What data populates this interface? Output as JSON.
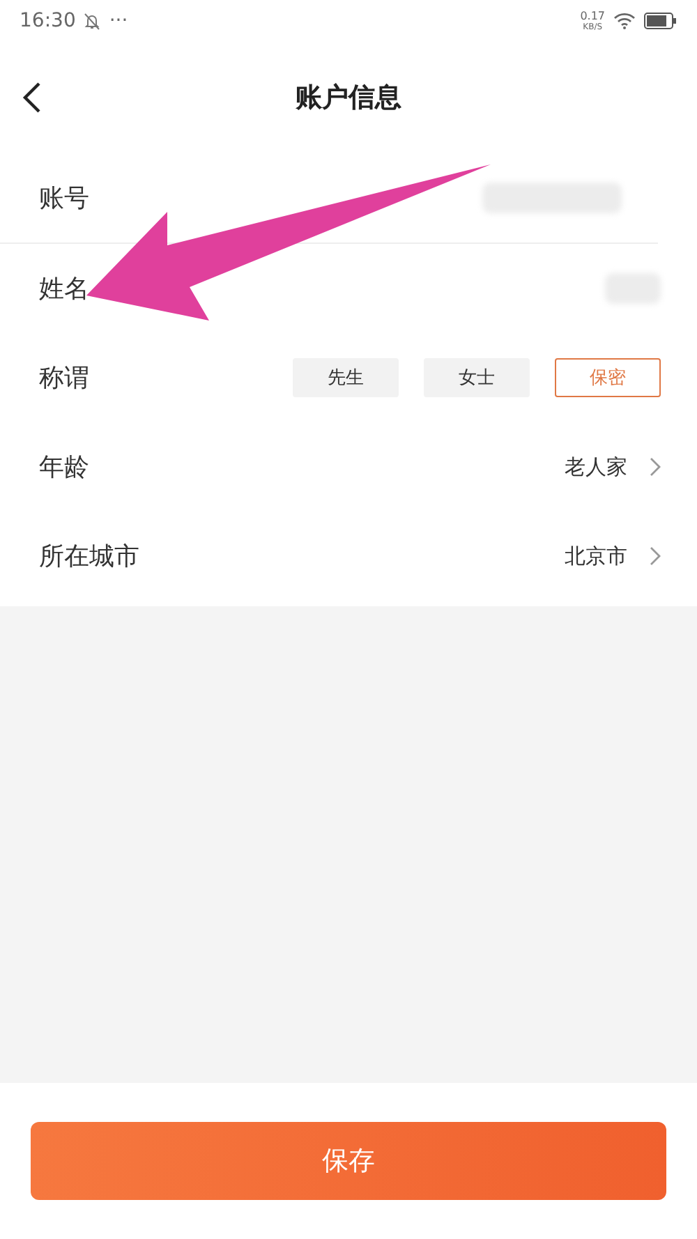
{
  "status_bar": {
    "time": "16:30",
    "more": "···",
    "speed_value": "0.17",
    "speed_unit": "KB/S"
  },
  "header": {
    "title": "账户信息"
  },
  "rows": [
    {
      "kind": "hidden",
      "label": "账号"
    },
    {
      "kind": "hidden",
      "label": "姓名"
    },
    {
      "kind": "options",
      "label": "称谓",
      "options": [
        {
          "label": "先生",
          "selected": false
        },
        {
          "label": "女士",
          "selected": false
        },
        {
          "label": "保密",
          "selected": true
        }
      ]
    },
    {
      "kind": "link",
      "label": "年龄",
      "value": "老人家"
    },
    {
      "kind": "link",
      "label": "所在城市",
      "value": "北京市"
    }
  ],
  "save_button": "保存"
}
